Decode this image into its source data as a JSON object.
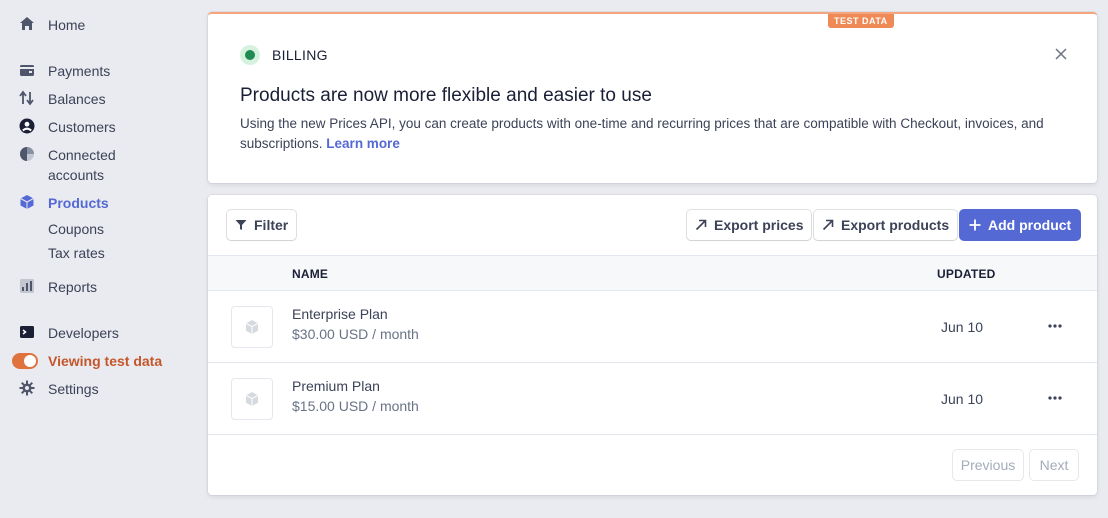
{
  "sidebar": {
    "items": [
      {
        "label": "Home",
        "icon": "home-icon"
      },
      {
        "label": "Payments",
        "icon": "wallet-icon"
      },
      {
        "label": "Balances",
        "icon": "arrows-icon"
      },
      {
        "label": "Customers",
        "icon": "person-icon"
      },
      {
        "label": "Connected",
        "label2": "accounts",
        "icon": "globe-icon"
      },
      {
        "label": "Products",
        "icon": "box-icon"
      },
      {
        "label": "Coupons"
      },
      {
        "label": "Tax rates"
      },
      {
        "label": "Reports",
        "icon": "chart-icon"
      },
      {
        "label": "Developers",
        "icon": "terminal-icon"
      },
      {
        "label": "Viewing test data",
        "icon": "toggle-icon"
      },
      {
        "label": "Settings",
        "icon": "gear-icon"
      }
    ]
  },
  "banner": {
    "badge": "TEST DATA",
    "label": "BILLING",
    "title": "Products are now more flexible and easier to use",
    "text": "Using the new Prices API, you can create products with one-time and recurring prices that are compatible with Checkout, invoices, and subscriptions. ",
    "link": "Learn more"
  },
  "toolbar": {
    "filter": "Filter",
    "export_prices": "Export prices",
    "export_products": "Export products",
    "add_product": "Add product"
  },
  "table": {
    "headers": {
      "name": "NAME",
      "updated": "UPDATED"
    },
    "rows": [
      {
        "name": "Enterprise Plan",
        "price": "$30.00 USD / month",
        "updated": "Jun 10"
      },
      {
        "name": "Premium Plan",
        "price": "$15.00 USD / month",
        "updated": "Jun 10"
      }
    ]
  },
  "pagination": {
    "previous": "Previous",
    "next": "Next"
  },
  "colors": {
    "accent": "#5469d4",
    "test": "#e0733d",
    "background": "#e9ebf0"
  }
}
